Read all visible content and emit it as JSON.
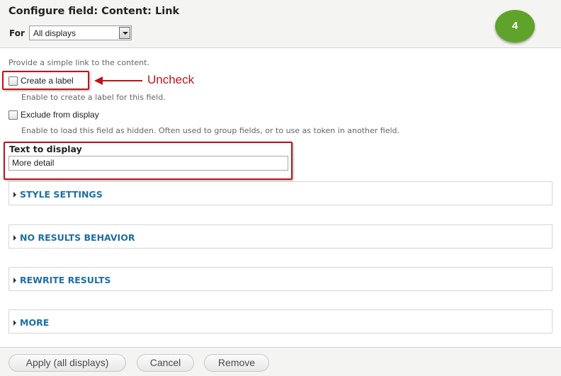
{
  "header": {
    "title": "Configure field: Content: Link",
    "for_label": "For",
    "display_select": {
      "selected": "All displays"
    }
  },
  "annotation": {
    "step_number": "4",
    "callout_text": "Uncheck",
    "accent_color": "#c0141b",
    "badge_color": "#5fa32b"
  },
  "form": {
    "description": "Provide a simple link to the content.",
    "create_label": {
      "label": "Create a label",
      "checked": false,
      "help": "Enable to create a label for this field."
    },
    "exclude": {
      "label": "Exclude from display",
      "checked": false,
      "help": "Enable to load this field as hidden. Often used to group fields, or to use as token in another field."
    },
    "text_to_display": {
      "label": "Text to display",
      "value": "More detail"
    },
    "sections": [
      {
        "title": "STYLE SETTINGS"
      },
      {
        "title": "NO RESULTS BEHAVIOR"
      },
      {
        "title": "REWRITE RESULTS"
      },
      {
        "title": "MORE"
      }
    ]
  },
  "footer": {
    "apply_label": "Apply (all displays)",
    "cancel_label": "Cancel",
    "remove_label": "Remove"
  },
  "colors": {
    "link": "#1d6fa5",
    "header_bg": "#f4f4f2"
  }
}
